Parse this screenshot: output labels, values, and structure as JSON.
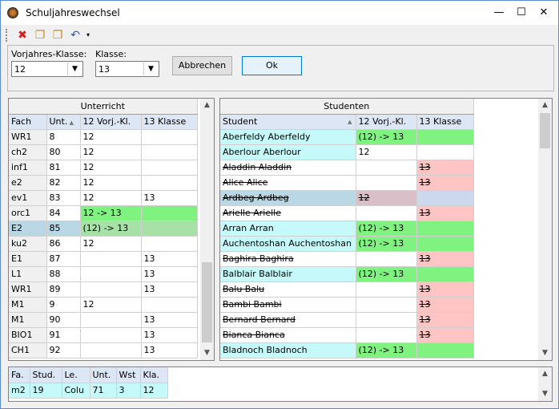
{
  "window": {
    "title": "Schuljahreswechsel"
  },
  "toolbar": {
    "icons": [
      "delete-icon",
      "copy-icon",
      "copy-all-icon",
      "undo-icon"
    ]
  },
  "form": {
    "prev_class_label": "Vorjahres-Klasse:",
    "prev_class_value": "12",
    "class_label": "Klasse:",
    "class_value": "13",
    "cancel_label": "Abbrechen",
    "ok_label": "Ok"
  },
  "unterricht": {
    "caption": "Unterricht",
    "headers": [
      "Fach",
      "Unt.",
      "12 Vorj.-Kl.",
      "13 Klasse"
    ],
    "rows": [
      [
        "WR1",
        "8",
        "12",
        ""
      ],
      [
        "ch2",
        "80",
        "12",
        ""
      ],
      [
        "inf1",
        "81",
        "12",
        ""
      ],
      [
        "e2",
        "82",
        "12",
        ""
      ],
      [
        "ev1",
        "83",
        "12",
        "13"
      ],
      [
        "orc1",
        "84",
        "12  ->  13",
        ""
      ],
      [
        "E2",
        "85",
        "(12)  ->  13",
        ""
      ],
      [
        "ku2",
        "86",
        "12",
        ""
      ],
      [
        "E1",
        "87",
        "",
        "13"
      ],
      [
        "L1",
        "88",
        "",
        "13"
      ],
      [
        "WR1",
        "89",
        "",
        "13"
      ],
      [
        "M1",
        "9",
        "12",
        ""
      ],
      [
        "M1",
        "90",
        "",
        "13"
      ],
      [
        "BIO1",
        "91",
        "",
        "13"
      ],
      [
        "CH1",
        "92",
        "",
        "13"
      ]
    ]
  },
  "studenten": {
    "caption": "Studenten",
    "headers": [
      "Student",
      "12 Vorj.-Kl.",
      "13 Klasse"
    ],
    "rows": [
      [
        "Aberfeldy Aberfeldy",
        "(12)  ->  13",
        ""
      ],
      [
        "Aberlour Aberlour",
        "12",
        ""
      ],
      [
        "Aladdin Aladdin",
        "",
        "13"
      ],
      [
        "Alice Alice",
        "",
        "13"
      ],
      [
        "Ardbeg Ardbeg",
        "12",
        ""
      ],
      [
        "Arielle Arielle",
        "",
        "13"
      ],
      [
        "Arran Arran",
        "(12)  ->  13",
        ""
      ],
      [
        "Auchentoshan Auchentoshan",
        "(12)  ->  13",
        ""
      ],
      [
        "Baghira Baghira",
        "",
        "13"
      ],
      [
        "Balblair Balblair",
        "(12)  ->  13",
        ""
      ],
      [
        "Balu Balu",
        "",
        "13"
      ],
      [
        "Bambi Bambi",
        "",
        "13"
      ],
      [
        "Bernard Bernard",
        "",
        "13"
      ],
      [
        "Bianca Bianca",
        "",
        "13"
      ],
      [
        "Bladnoch Bladnoch",
        "(12)  ->  13",
        ""
      ]
    ]
  },
  "bottom": {
    "headers": [
      "Fa.",
      "Stud.",
      "Le.",
      "Unt.",
      "Wst",
      "Kla."
    ],
    "row": [
      "m2",
      "19",
      "Colu",
      "71",
      "3",
      "12"
    ]
  }
}
